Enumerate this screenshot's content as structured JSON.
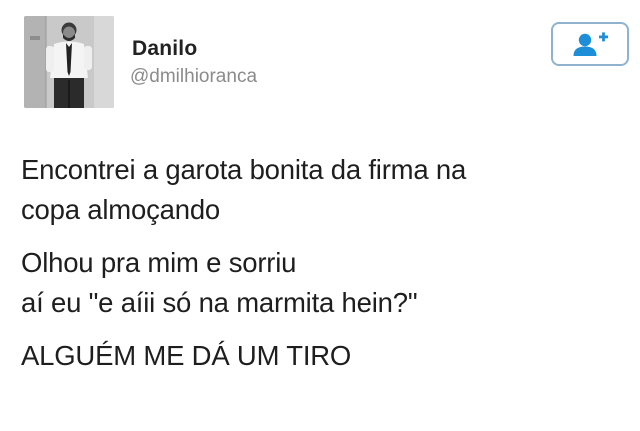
{
  "user": {
    "display_name": "Danilo",
    "handle": "@dmilhioranca",
    "avatar_icon": "profile-photo"
  },
  "follow_button": {
    "icon": "add-user-icon",
    "accent_color": "#1d8fd8"
  },
  "tweet": {
    "paragraphs": [
      {
        "lines": [
          "Encontrei a garota bonita da firma na",
          "copa almoçando"
        ]
      },
      {
        "lines": [
          "Olhou pra mim e sorriu",
          "aí eu \"e aíii só na marmita hein?\""
        ]
      },
      {
        "lines": [
          "ALGUÉM ME DÁ UM TIRO"
        ]
      }
    ]
  }
}
